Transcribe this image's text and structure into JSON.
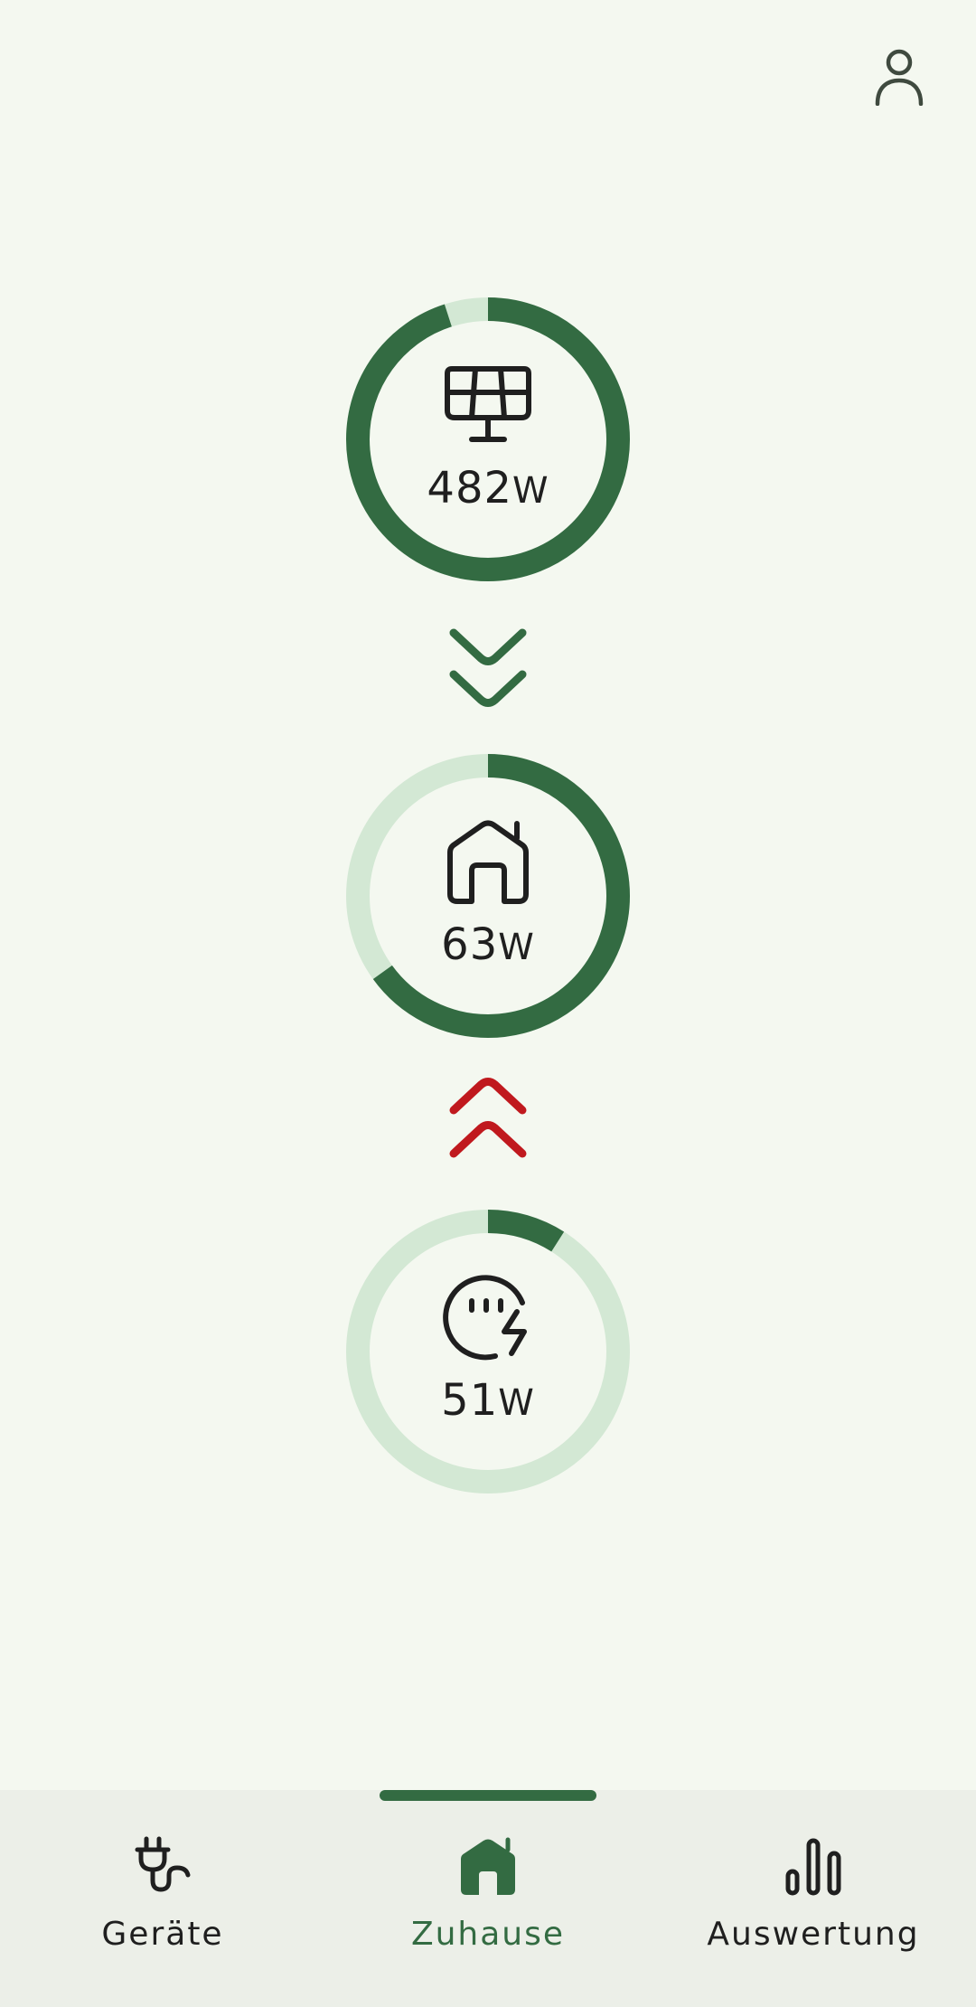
{
  "header": {
    "profile_icon": "person-icon"
  },
  "gauges": [
    {
      "name": "solar",
      "icon": "solar-panel-icon",
      "value": "482",
      "unit": "W",
      "fill_fraction": 0.95,
      "color": "#336b42"
    },
    {
      "name": "home",
      "icon": "house-icon",
      "value": "63",
      "unit": "W",
      "fill_fraction": 0.65,
      "color": "#336b42"
    },
    {
      "name": "grid",
      "icon": "meter-bolt-icon",
      "value": "51",
      "unit": "W",
      "fill_fraction": 0.09,
      "color": "#336b42"
    }
  ],
  "flows": [
    {
      "direction": "down",
      "icon": "double-chevron-down-icon",
      "color": "#336b42"
    },
    {
      "direction": "up",
      "icon": "double-chevron-up-icon",
      "color": "#c0191e"
    }
  ],
  "colors": {
    "track": "#d3e8d4",
    "accent": "#336b42",
    "warning": "#c0191e",
    "background": "#f4f8f0",
    "nav_background": "#ecefe8"
  },
  "nav": {
    "items": [
      {
        "label": "Geräte",
        "icon": "plug-icon",
        "active": false
      },
      {
        "label": "Zuhause",
        "icon": "home-filled-icon",
        "active": true
      },
      {
        "label": "Auswertung",
        "icon": "bar-chart-icon",
        "active": false
      }
    ]
  }
}
